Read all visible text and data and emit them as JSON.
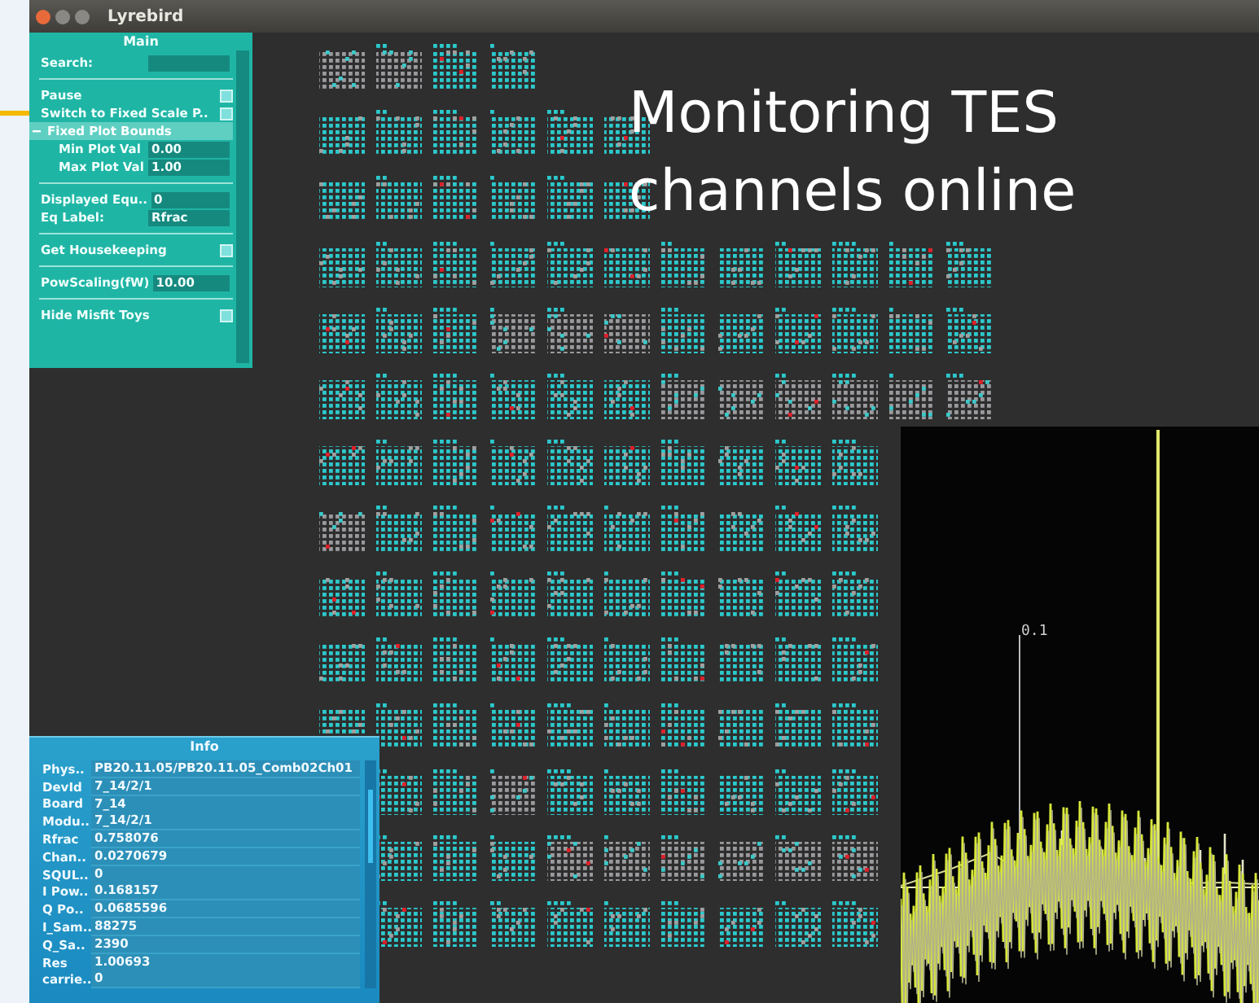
{
  "window": {
    "title": "Lyrebird"
  },
  "main_panel": {
    "title": "Main",
    "sections": [
      {
        "items": [
          {
            "kind": "field",
            "label": "Search:",
            "value": ""
          }
        ]
      },
      {
        "items": [
          {
            "kind": "checkbox",
            "label": "Pause",
            "checked": false
          },
          {
            "kind": "checkbox",
            "label": "Switch to Fixed Scale P..",
            "checked": false
          },
          {
            "kind": "group",
            "label": "Fixed Plot Bounds",
            "expanded": true
          },
          {
            "kind": "field",
            "label": "Min Plot Val",
            "value": "0.00",
            "indented": true
          },
          {
            "kind": "field",
            "label": "Max Plot Val",
            "value": "1.00",
            "indented": true
          }
        ]
      },
      {
        "items": [
          {
            "kind": "field",
            "label": "Displayed Equ..",
            "value": "0"
          },
          {
            "kind": "field",
            "label": "Eq Label:",
            "value": "Rfrac"
          }
        ]
      },
      {
        "items": [
          {
            "kind": "checkbox",
            "label": "Get Housekeeping",
            "checked": false
          }
        ]
      },
      {
        "items": [
          {
            "kind": "field",
            "label": "PowScaling(fW)",
            "value": "10.00"
          }
        ]
      },
      {
        "items": [
          {
            "kind": "checkbox",
            "label": "Hide Misfit Toys",
            "checked": false
          }
        ]
      }
    ]
  },
  "info_panel": {
    "title": "Info",
    "rows": [
      {
        "label": "Phys..",
        "value": "PB20.11.05/PB20.11.05_Comb02Ch01"
      },
      {
        "label": "DevId",
        "value": "7_14/2/1"
      },
      {
        "label": "Board",
        "value": "7_14"
      },
      {
        "label": "Modu..",
        "value": "7_14/2/1"
      },
      {
        "label": "Rfrac",
        "value": "0.758076"
      },
      {
        "label": "Chan..",
        "value": "0.0270679"
      },
      {
        "label": "SQUL..",
        "value": "0"
      },
      {
        "label": "I Pow..",
        "value": "0.168157"
      },
      {
        "label": "Q Po..",
        "value": "0.0685596"
      },
      {
        "label": "I_Sam..",
        "value": "88275"
      },
      {
        "label": "Q_Sa..",
        "value": "2390"
      },
      {
        "label": "Res",
        "value": "1.00693"
      },
      {
        "label": "carrie..",
        "value": "0"
      }
    ]
  },
  "plot": {
    "label": "0.1"
  },
  "caption": "Monitoring TES channels online"
}
